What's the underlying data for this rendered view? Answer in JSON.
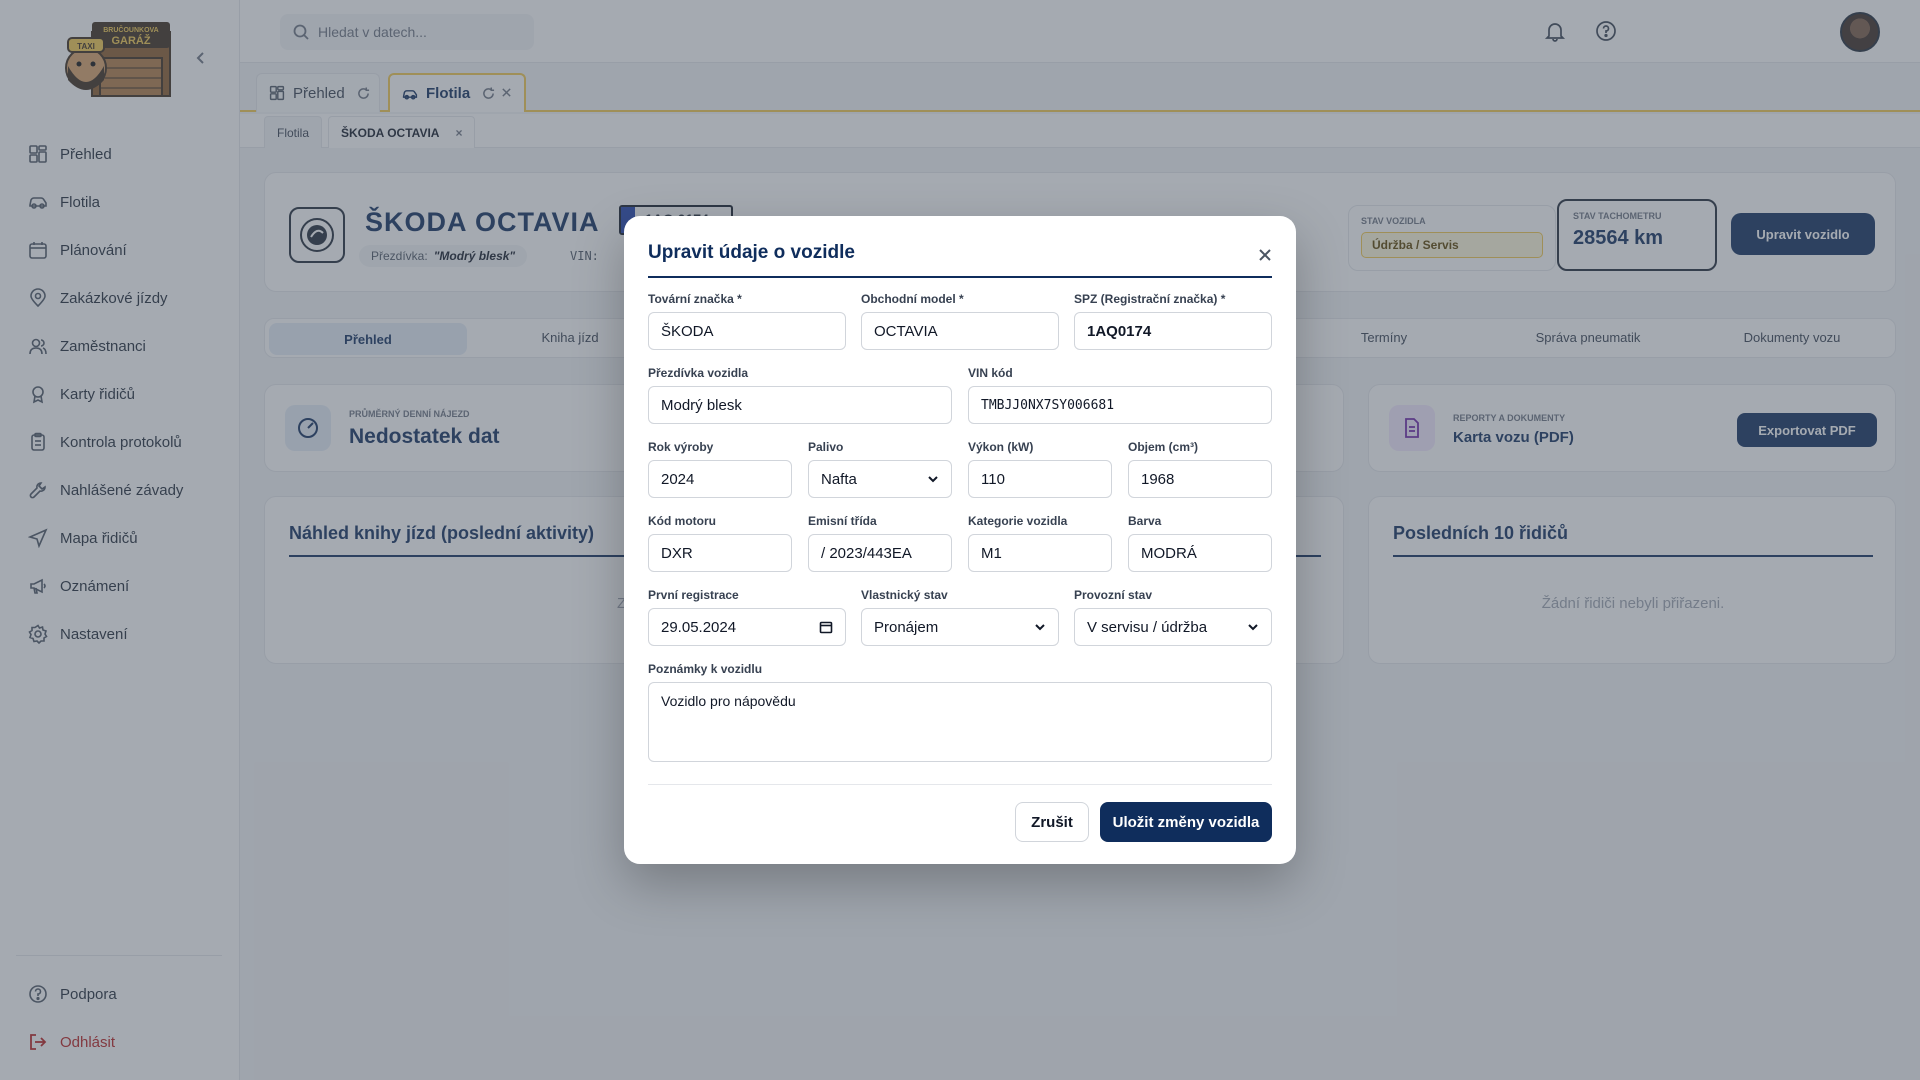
{
  "sidebar": {
    "items": [
      {
        "label": "Přehled",
        "icon": "dashboard-icon"
      },
      {
        "label": "Flotila",
        "icon": "car-icon"
      },
      {
        "label": "Plánování",
        "icon": "calendar-icon"
      },
      {
        "label": "Zakázkové jízdy",
        "icon": "map-pin-icon"
      },
      {
        "label": "Zaměstnanci",
        "icon": "users-icon"
      },
      {
        "label": "Karty řidičů",
        "icon": "badge-icon"
      },
      {
        "label": "Kontrola protokolů",
        "icon": "clipboard-icon"
      },
      {
        "label": "Nahlášené závady",
        "icon": "wrench-icon"
      },
      {
        "label": "Mapa řidičů",
        "icon": "navigation-icon"
      },
      {
        "label": "Oznámení",
        "icon": "megaphone-icon"
      },
      {
        "label": "Nastavení",
        "icon": "gear-icon"
      }
    ],
    "support": "Podpora",
    "logout": "Odhlásit",
    "logo": {
      "line1": "BRUČOUNKOVA",
      "line2": "GARÁŽ",
      "badge": "TAXI"
    }
  },
  "topbar": {
    "search_placeholder": "Hledat v datech..."
  },
  "tabs": [
    {
      "label": "Přehled"
    },
    {
      "label": "Flotila"
    }
  ],
  "subtabs": [
    {
      "label": "Flotila"
    },
    {
      "label": "ŠKODA OCTAVIA"
    }
  ],
  "vehicle": {
    "title": "ŠKODA OCTAVIA",
    "plate": "1AQ 0174",
    "nickname_label": "Přezdívka:",
    "nickname": "\"Modrý blesk\"",
    "vin_label": "VIN:",
    "status_label": "STAV VOZIDLA",
    "status_value": "Údržba / Servis",
    "odometer_label": "STAV TACHOMETRU",
    "odometer_value": "28564 km",
    "edit_button": "Upravit vozidlo"
  },
  "vehicle_tabs": [
    "Přehled",
    "Kniha jízd",
    "Termíny",
    "Správa pneumatik",
    "Dokumenty vozu"
  ],
  "cards": {
    "avg_label": "PRŮMĚRNÝ DENNÍ NÁJEZD",
    "avg_value": "Nedostatek dat",
    "reports_label": "REPORTY A DOKUMENTY",
    "reports_value": "Karta vozu (PDF)",
    "export_button": "Exportovat PDF",
    "logbook_title": "Náhled knihy jízd (poslední aktivity)",
    "logbook_empty": "Z",
    "drivers_title": "Posledních 10 řidičů",
    "drivers_empty": "Žádní řidiči nebyli přiřazeni."
  },
  "modal": {
    "title": "Upravit údaje o vozidle",
    "fields": {
      "brand": {
        "label": "Tovární značka *",
        "value": "ŠKODA"
      },
      "model": {
        "label": "Obchodní model *",
        "value": "OCTAVIA"
      },
      "plate": {
        "label": "SPZ (Registrační značka) *",
        "value": "1AQ0174"
      },
      "nickname": {
        "label": "Přezdívka vozidla",
        "value": "Modrý blesk"
      },
      "vin": {
        "label": "VIN kód",
        "value": "TMBJJ0NX7SY006681"
      },
      "year": {
        "label": "Rok výroby",
        "value": "2024"
      },
      "fuel": {
        "label": "Palivo",
        "value": "Nafta"
      },
      "power": {
        "label": "Výkon (kW)",
        "value": "110"
      },
      "volume": {
        "label": "Objem (cm³)",
        "value": "1968"
      },
      "engine": {
        "label": "Kód motoru",
        "value": "DXR"
      },
      "emission": {
        "label": "Emisní třída",
        "value": "/ 2023/443EA"
      },
      "category": {
        "label": "Kategorie vozidla",
        "value": "M1"
      },
      "color": {
        "label": "Barva",
        "value": "MODRÁ"
      },
      "first_reg": {
        "label": "První registrace",
        "value": "29.05.2024"
      },
      "ownership": {
        "label": "Vlastnický stav",
        "value": "Pronájem"
      },
      "operational": {
        "label": "Provozní stav",
        "value": "V servisu / údržba"
      },
      "notes": {
        "label": "Poznámky k vozidlu",
        "value": "Vozidlo pro nápovědu"
      }
    },
    "cancel": "Zrušit",
    "save": "Uložit změny vozidla"
  },
  "colors": {
    "primary": "#0f2d5c",
    "accent": "#f2c94c",
    "danger": "#b91c1c"
  }
}
